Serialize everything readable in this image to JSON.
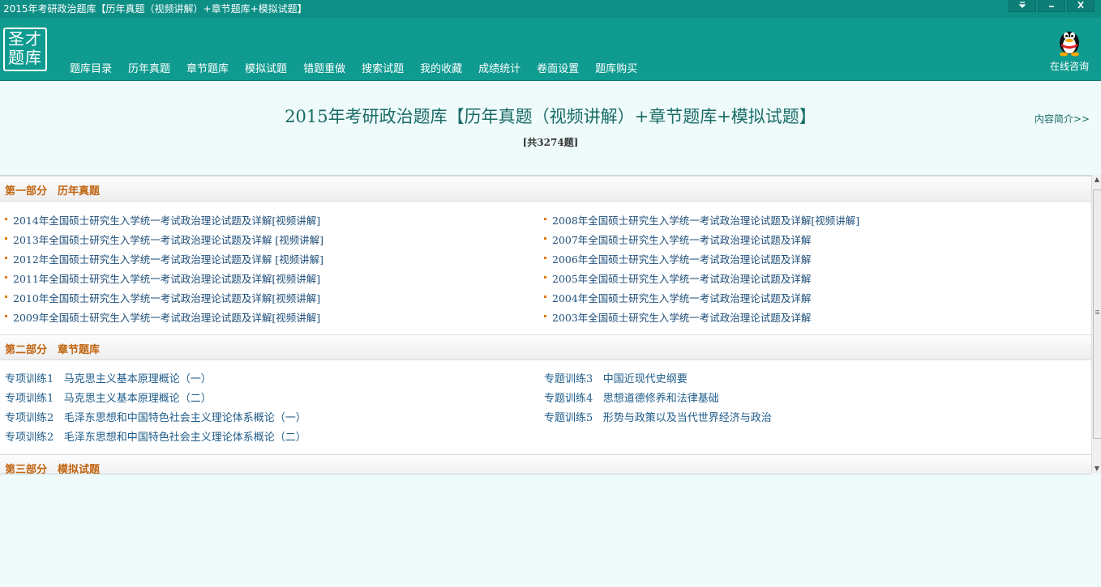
{
  "window": {
    "title": "2015年考研政治题库【历年真题（视频讲解）+章节题库+模拟试题】",
    "controls": [
      "dropdown-icon",
      "minimize-icon",
      "close-icon"
    ]
  },
  "logo": {
    "line1": "圣才",
    "line2": "题库"
  },
  "menu": [
    "题库目录",
    "历年真题",
    "章节题库",
    "模拟试题",
    "错题重做",
    "搜索试题",
    "我的收藏",
    "成绩统计",
    "卷面设置",
    "题库购买"
  ],
  "consult": {
    "label": "在线咨询",
    "icon": "qq-penguin-icon"
  },
  "header": {
    "title": "2015年考研政治题库【历年真题（视频讲解）+章节题库+模拟试题】",
    "count": "[共3274题]",
    "intro_link": "内容简介>>"
  },
  "sections": [
    {
      "title": "第一部分　历年真题",
      "left": [
        "2014年全国硕士研究生入学统一考试政治理论试题及详解[视频讲解]",
        "2013年全国硕士研究生入学统一考试政治理论试题及详解 [视频讲解]",
        "2012年全国硕士研究生入学统一考试政治理论试题及详解 [视频讲解]",
        "2011年全国硕士研究生入学统一考试政治理论试题及详解[视频讲解]",
        "2010年全国硕士研究生入学统一考试政治理论试题及详解[视频讲解]",
        "2009年全国硕士研究生入学统一考试政治理论试题及详解[视频讲解]"
      ],
      "right": [
        "2008年全国硕士研究生入学统一考试政治理论试题及详解[视频讲解]",
        "2007年全国硕士研究生入学统一考试政治理论试题及详解",
        "2006年全国硕士研究生入学统一考试政治理论试题及详解",
        "2005年全国硕士研究生入学统一考试政治理论试题及详解",
        "2004年全国硕士研究生入学统一考试政治理论试题及详解",
        "2003年全国硕士研究生入学统一考试政治理论试题及详解"
      ]
    },
    {
      "title": "第二部分　章节题库",
      "left": [
        {
          "label": "专项训练1",
          "name": "马克思主义基本原理概论（一）"
        },
        {
          "label": "专项训练1",
          "name": "马克思主义基本原理概论（二）"
        },
        {
          "label": "专项训练2",
          "name": "毛泽东思想和中国特色社会主义理论体系概论（一）"
        },
        {
          "label": "专项训练2",
          "name": "毛泽东思想和中国特色社会主义理论体系概论（二）"
        }
      ],
      "right": [
        {
          "label": "专题训练3",
          "name": "中国近现代史纲要"
        },
        {
          "label": "专题训练4",
          "name": "思想道德修养和法律基础"
        },
        {
          "label": "专题训练5",
          "name": "形势与政策以及当代世界经济与政治"
        }
      ]
    },
    {
      "title": "第三部分　模拟试题"
    }
  ],
  "colors": {
    "teal": "#0f9b90",
    "section_title": "#c0640f",
    "link": "#1f4f7a",
    "bullet": "#e07a00"
  }
}
